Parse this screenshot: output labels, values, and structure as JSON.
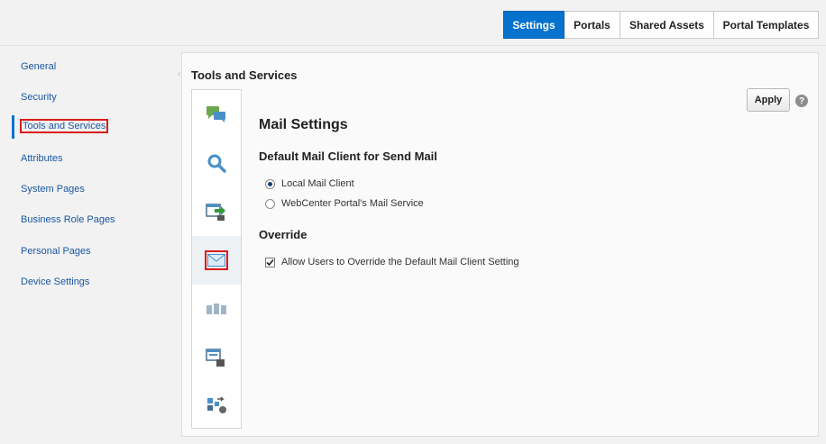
{
  "tabs": [
    {
      "label": "Settings",
      "active": true
    },
    {
      "label": "Portals"
    },
    {
      "label": "Shared Assets"
    },
    {
      "label": "Portal Templates"
    }
  ],
  "sidebar": {
    "items": [
      {
        "label": "General"
      },
      {
        "label": "Security"
      },
      {
        "label": "Tools and Services",
        "selected": true
      },
      {
        "label": "Attributes"
      },
      {
        "label": "System Pages"
      },
      {
        "label": "Business Role Pages"
      },
      {
        "label": "Personal Pages"
      },
      {
        "label": "Device Settings"
      }
    ]
  },
  "panel": {
    "title": "Tools and Services",
    "apply_label": "Apply",
    "help_glyph": "?",
    "icon_strip": [
      "discussions-icon",
      "search-icon",
      "import-export-icon",
      "mail-icon",
      "people-icon",
      "presence-icon",
      "services-icon"
    ],
    "mail": {
      "heading": "Mail Settings",
      "client_heading": "Default Mail Client for Send Mail",
      "options": [
        {
          "label": "Local Mail Client",
          "selected": true
        },
        {
          "label": "WebCenter Portal's Mail Service",
          "selected": false
        }
      ],
      "override_heading": "Override",
      "override_checkbox": {
        "label": "Allow Users to Override the Default Mail Client Setting",
        "checked": true
      }
    }
  },
  "colors": {
    "accent": "#0572ce",
    "highlight_box": "#d91c1c",
    "link": "#1a57a3"
  }
}
